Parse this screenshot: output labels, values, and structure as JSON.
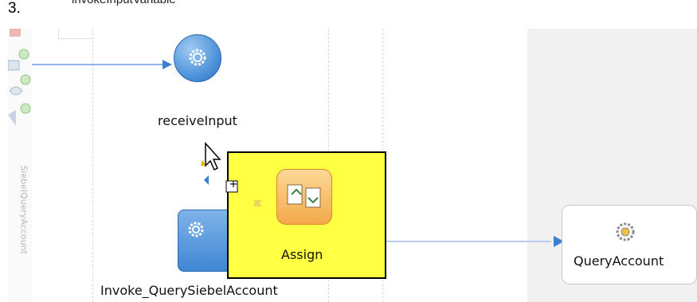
{
  "step_number": "3.",
  "top_partial_text": "invokeInputVariable",
  "sidebar": {
    "partner_link_label": "SiebelQueryAccount"
  },
  "activities": {
    "receive": {
      "label": "receiveInput",
      "icon": "gear-icon"
    },
    "invoke": {
      "label": "Invoke_QuerySiebelAccount",
      "icon": "gear-icon"
    },
    "assign": {
      "label": "Assign",
      "icon": "assign-icon"
    }
  },
  "partner_link": {
    "label": "QueryAccount",
    "icon": "gear-icon"
  },
  "colors": {
    "assign_highlight": "#ffff44",
    "activity_blue": "#4a90d9",
    "link_line": "#8fb4ea",
    "assign_icon_fill": "#f8c271"
  },
  "drag_indicator": {
    "plus_symbol": "+"
  }
}
